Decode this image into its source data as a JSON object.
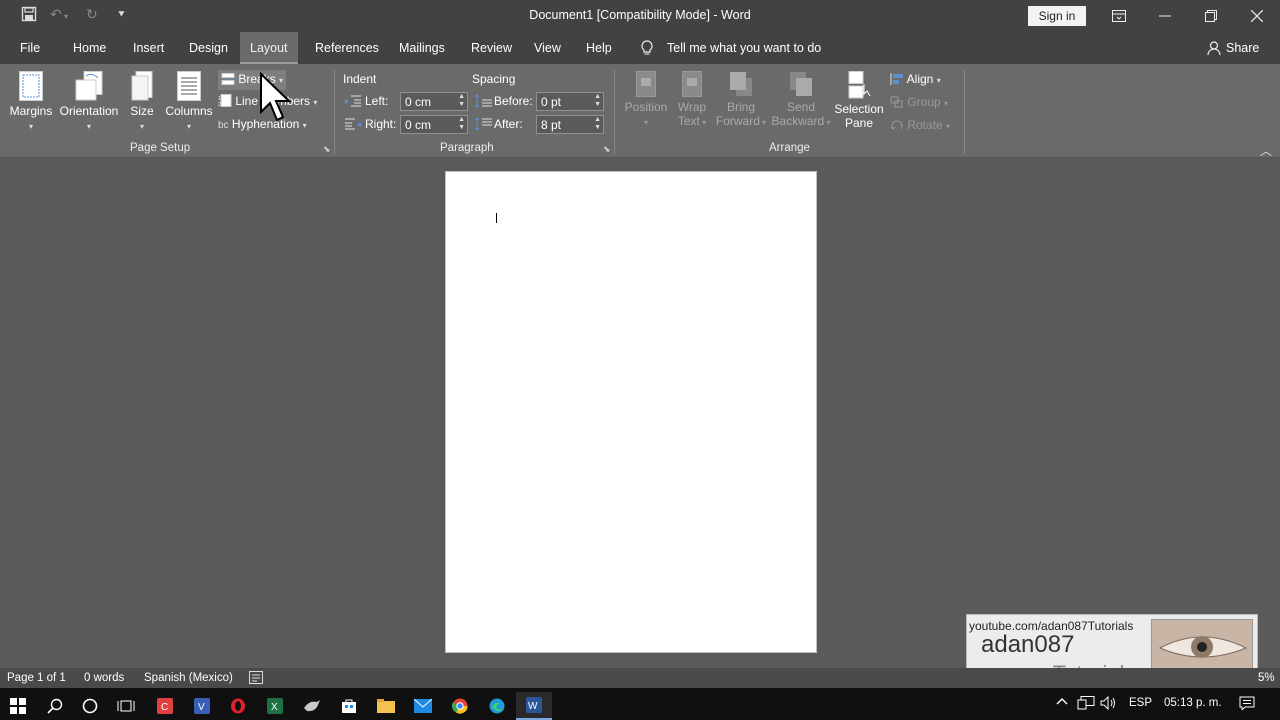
{
  "window": {
    "title": "Document1 [Compatibility Mode]  -  Word",
    "sign_in": "Sign in"
  },
  "tabs": [
    "File",
    "Home",
    "Insert",
    "Design",
    "Layout",
    "References",
    "Mailings",
    "Review",
    "View",
    "Help"
  ],
  "active_tab": "Layout",
  "tell_me": "Tell me what you want to do",
  "share": "Share",
  "ribbon": {
    "page_setup": {
      "margins": "Margins",
      "orientation": "Orientation",
      "size": "Size",
      "columns": "Columns",
      "breaks": "Breaks",
      "line_numbers": "Line Numbers",
      "hyphenation": "Hyphenation",
      "group_label": "Page Setup"
    },
    "paragraph": {
      "indent_label": "Indent",
      "spacing_label": "Spacing",
      "left_label": "Left:",
      "left_value": "0 cm",
      "right_label": "Right:",
      "right_value": "0 cm",
      "before_label": "Before:",
      "before_value": "0 pt",
      "after_label": "After:",
      "after_value": "8 pt",
      "group_label": "Paragraph"
    },
    "arrange": {
      "position_1": "Position",
      "wrap_1": "Wrap",
      "wrap_2": "Text",
      "bring_1": "Bring",
      "bring_2": "Forward",
      "send_1": "Send",
      "send_2": "Backward",
      "selection_1": "Selection",
      "selection_2": "Pane",
      "align": "Align",
      "group": "Group",
      "rotate": "Rotate",
      "group_label": "Arrange"
    }
  },
  "status": {
    "page": "Page 1 of 1",
    "words": "0 words",
    "language": "Spanish (Mexico)",
    "zoom_fragment": "5%"
  },
  "watermark": {
    "url": "youtube.com/adan087Tutorials",
    "name": "adan087",
    "tag": "Tutorials"
  },
  "tray": {
    "lang": "ESP",
    "time": "05:13 p. m."
  }
}
